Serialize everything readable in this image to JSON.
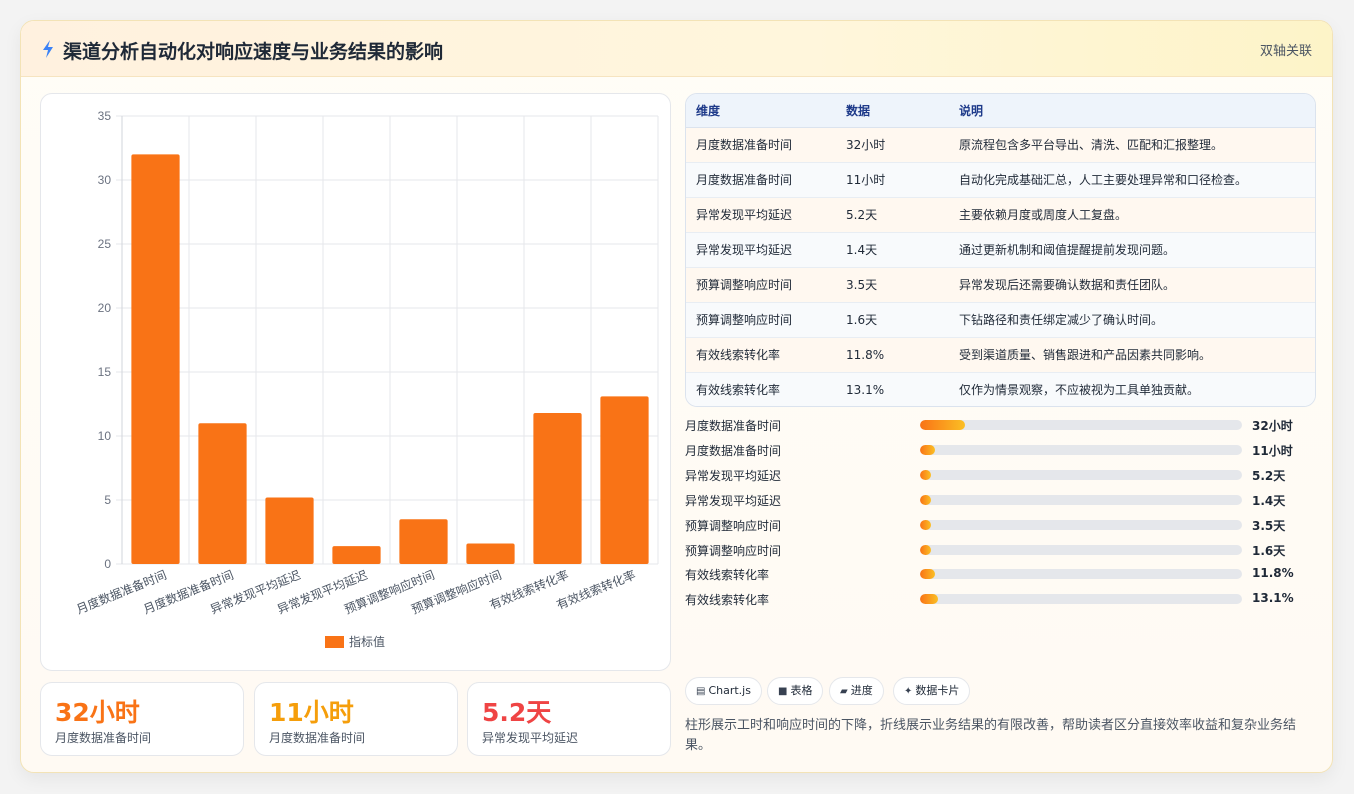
{
  "header": {
    "title": "渠道分析自动化对响应速度与业务结果的影响",
    "tag": "双轴关联"
  },
  "chart_data": {
    "type": "bar",
    "categories": [
      "月度数据准备时间",
      "月度数据准备时间",
      "异常发现平均延迟",
      "异常发现平均延迟",
      "预算调整响应时间",
      "预算调整响应时间",
      "有效线索转化率",
      "有效线索转化率"
    ],
    "series": [
      {
        "name": "指标值",
        "values": [
          32,
          11,
          5.2,
          1.4,
          3.5,
          1.6,
          11.8,
          13.1
        ]
      }
    ],
    "ylim": [
      0,
      35
    ],
    "yticks": [
      0,
      5,
      10,
      15,
      20,
      25,
      30,
      35
    ],
    "grid": true,
    "legend": "bottom",
    "color": "#f97316"
  },
  "kpis": [
    {
      "value": "32小时",
      "label": "月度数据准备时间",
      "color": "#f97316"
    },
    {
      "value": "11小时",
      "label": "月度数据准备时间",
      "color": "#f59e0b"
    },
    {
      "value": "5.2天",
      "label": "异常发现平均延迟",
      "color": "#ef4444"
    }
  ],
  "table": {
    "headers": [
      "维度",
      "数据",
      "说明"
    ],
    "rows": [
      [
        "月度数据准备时间",
        "32小时",
        "原流程包含多平台导出、清洗、匹配和汇报整理。"
      ],
      [
        "月度数据准备时间",
        "11小时",
        "自动化完成基础汇总，人工主要处理异常和口径检查。"
      ],
      [
        "异常发现平均延迟",
        "5.2天",
        "主要依赖月度或周度人工复盘。"
      ],
      [
        "异常发现平均延迟",
        "1.4天",
        "通过更新机制和阈值提醒提前发现问题。"
      ],
      [
        "预算调整响应时间",
        "3.5天",
        "异常发现后还需要确认数据和责任团队。"
      ],
      [
        "预算调整响应时间",
        "1.6天",
        "下钻路径和责任绑定减少了确认时间。"
      ],
      [
        "有效线索转化率",
        "11.8%",
        "受到渠道质量、销售跟进和产品因素共同影响。"
      ],
      [
        "有效线索转化率",
        "13.1%",
        "仅作为情景观察，不应被视为工具单独贡献。"
      ]
    ]
  },
  "progress": [
    {
      "label": "月度数据准备时间",
      "value": "32小时",
      "fraction": 0.14
    },
    {
      "label": "月度数据准备时间",
      "value": "11小时",
      "fraction": 0.048
    },
    {
      "label": "异常发现平均延迟",
      "value": "5.2天",
      "fraction": 0.035
    },
    {
      "label": "异常发现平均延迟",
      "value": "1.4天",
      "fraction": 0.035
    },
    {
      "label": "预算调整响应时间",
      "value": "3.5天",
      "fraction": 0.035
    },
    {
      "label": "预算调整响应时间",
      "value": "1.6天",
      "fraction": 0.035
    },
    {
      "label": "有效线索转化率",
      "value": "11.8%",
      "fraction": 0.048
    },
    {
      "label": "有效线索转化率",
      "value": "13.1%",
      "fraction": 0.057
    }
  ],
  "chips": [
    {
      "icon": "chart-icon",
      "label": "Chart.js"
    },
    {
      "icon": "table-icon",
      "label": "表格"
    },
    {
      "icon": "progress-icon",
      "label": "进度"
    },
    {
      "icon": "sparkle-icon",
      "label": "数据卡片"
    }
  ],
  "description": "柱形展示工时和响应时间的下降，折线展示业务结果的有限改善，帮助读者区分直接效率收益和复杂业务结果。"
}
